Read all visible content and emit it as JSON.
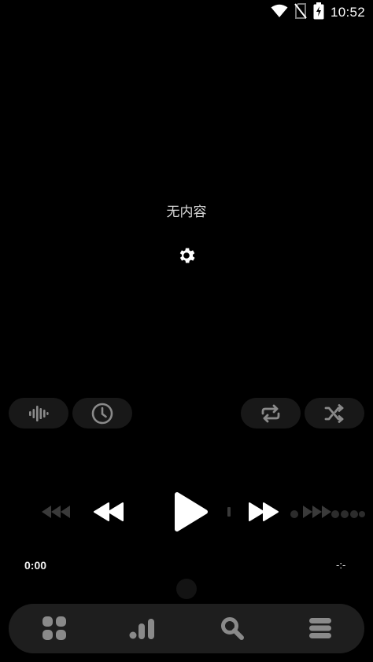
{
  "status_bar": {
    "time": "10:52",
    "icons": [
      "wifi-icon",
      "no-sim-icon",
      "battery-charging-icon"
    ]
  },
  "empty_state": {
    "message": "无内容",
    "settings_icon": "gear-icon"
  },
  "controls": {
    "left": [
      "waveform-icon",
      "clock-icon"
    ],
    "right": [
      "repeat-icon",
      "shuffle-icon"
    ]
  },
  "transport": {
    "icons": [
      "skip-back-icon",
      "rewind-icon",
      "play-icon",
      "fast-forward-icon",
      "skip-forward-icon"
    ]
  },
  "progress": {
    "elapsed": "0:00",
    "duration": "-:-"
  },
  "bottom_nav": {
    "items": [
      "grid-icon",
      "chart-icon",
      "search-icon",
      "menu-icon"
    ]
  },
  "colors": {
    "background": "#000000",
    "pill": "#181818",
    "nav_bar": "#1e1e1e",
    "icon_muted": "#8a8a8a",
    "icon_dim": "#3a3a3a",
    "text": "#d8d8d8"
  }
}
